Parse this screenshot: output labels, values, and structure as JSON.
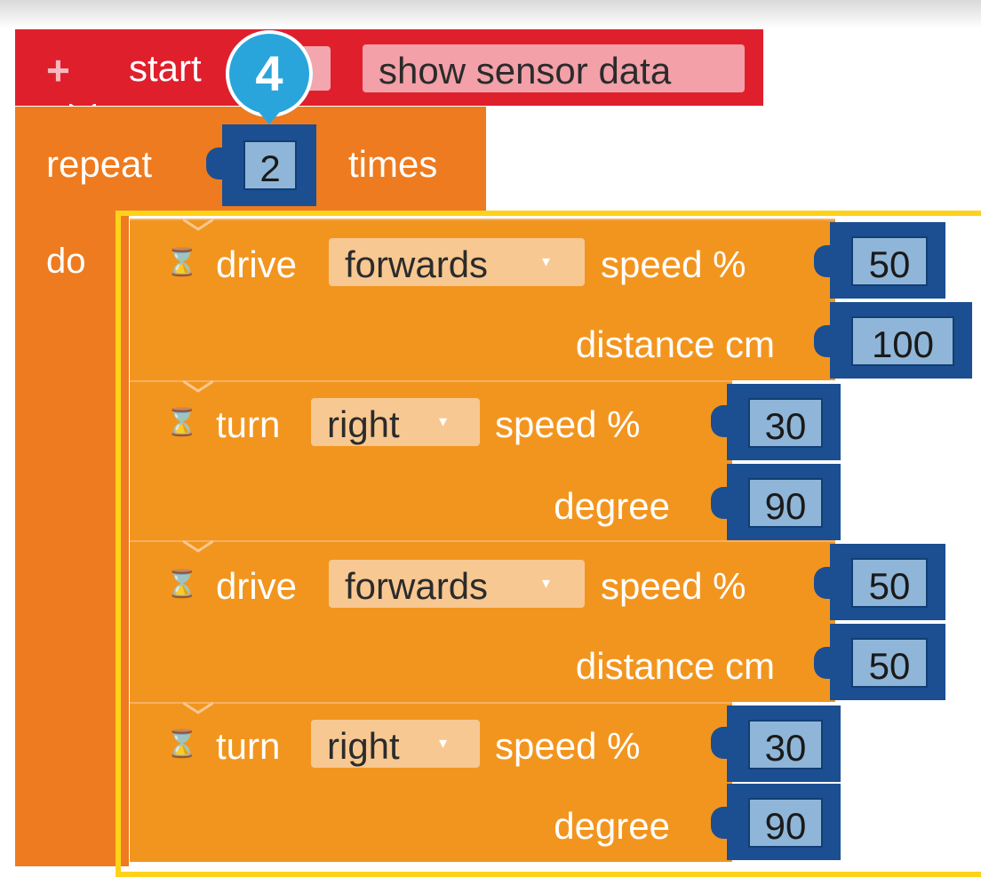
{
  "hat": {
    "plus": "+",
    "label": "start",
    "field_label": "show sensor data"
  },
  "badge": {
    "number": "4"
  },
  "repeat": {
    "label": "repeat",
    "count": "2",
    "times_label": "times",
    "do_label": "do"
  },
  "blocks": [
    {
      "verb": "drive",
      "direction": "forwards",
      "speed_label": "speed %",
      "speed": "50",
      "param_label": "distance cm",
      "param_value": "100"
    },
    {
      "verb": "turn",
      "direction": "right",
      "speed_label": "speed %",
      "speed": "30",
      "param_label": "degree",
      "param_value": "90"
    },
    {
      "verb": "drive",
      "direction": "forwards",
      "speed_label": "speed %",
      "speed": "50",
      "param_label": "distance cm",
      "param_value": "50"
    },
    {
      "verb": "turn",
      "direction": "right",
      "speed_label": "speed %",
      "speed": "30",
      "param_label": "degree",
      "param_value": "90"
    }
  ],
  "icons": {
    "hourglass": "hourglass-icon",
    "dropdown": "dropdown-arrow-icon"
  },
  "colors": {
    "hat": "#e01f2d",
    "repeat": "#ee7b1f",
    "command": "#f2951f",
    "socket": "#1b4f91",
    "socket_value": "#8fb6d8",
    "badge": "#2aa5dc",
    "highlight": "#ffd21a"
  }
}
